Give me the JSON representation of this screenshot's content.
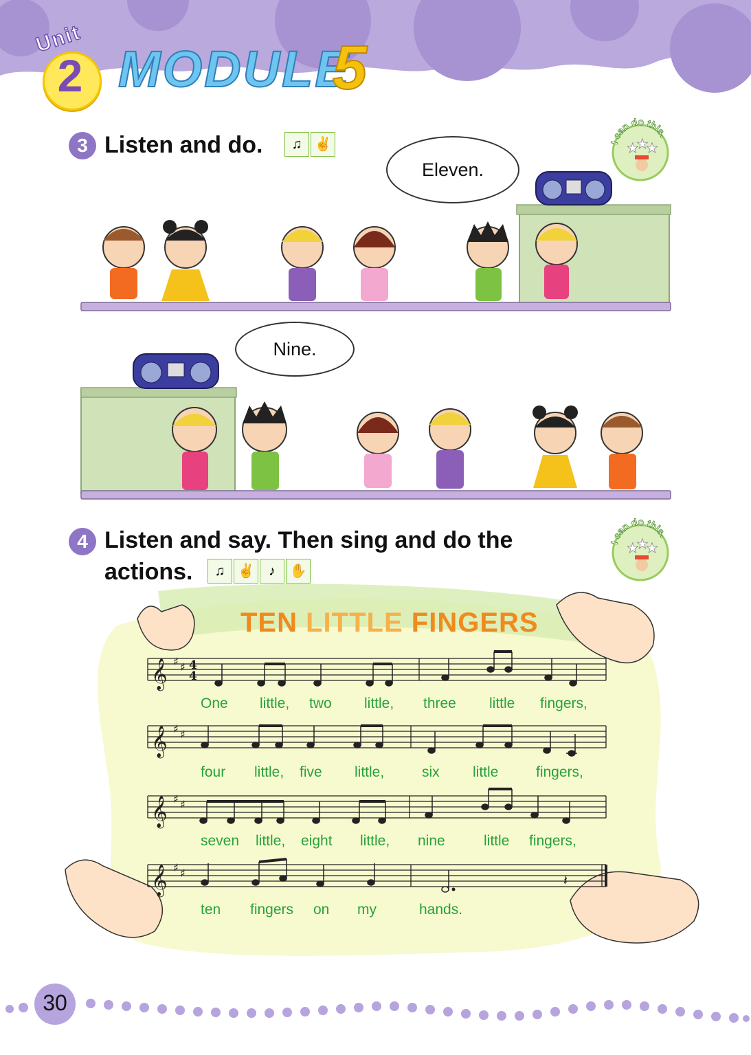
{
  "header": {
    "unit_label": "Unit",
    "unit_number": "2",
    "module_label": "MODULE",
    "module_number": "5"
  },
  "section3": {
    "number": "3",
    "title": "Listen and do.",
    "bubble_top": "Eleven.",
    "bubble_bottom": "Nine."
  },
  "section4": {
    "number": "4",
    "title_line1": "Listen and say. Then sing and do the",
    "title_line2": "actions."
  },
  "badge": {
    "text": "I can do this."
  },
  "song": {
    "title_word1": "TEN",
    "title_word2": "LITTLE",
    "title_word3": "FINGERS",
    "lines": [
      [
        "One",
        "little,",
        "two",
        "little,",
        "three",
        "little",
        "fingers,"
      ],
      [
        "four",
        "little,",
        "five",
        "little,",
        "six",
        "little",
        "fingers,"
      ],
      [
        "seven",
        "little,",
        "eight",
        "little,",
        "nine",
        "little",
        "fingers,"
      ],
      [
        "ten",
        "fingers",
        "on",
        "my",
        "hands."
      ]
    ]
  },
  "page": {
    "number": "30"
  },
  "colors": {
    "header_purple": "#b9a9dc",
    "accent_purple": "#8e75c5",
    "lyric_green": "#28a23c",
    "title_orange": "#f08a1e",
    "shelf_purple": "#c7b0dd",
    "block_green": "#cfe2b8"
  }
}
